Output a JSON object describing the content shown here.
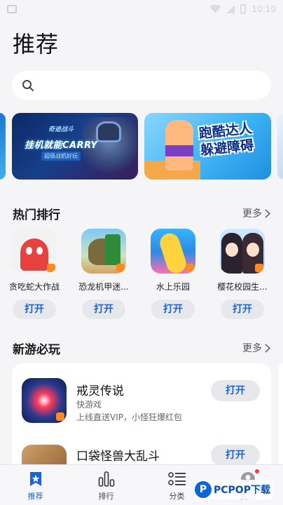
{
  "status_bar": {
    "time": "10:10"
  },
  "page": {
    "title": "推荐"
  },
  "search": {
    "placeholder": ""
  },
  "banners": [
    {
      "subtitle": "奇迹战斗",
      "headline": "挂机就能CARRY",
      "tag": "超级战机好玩"
    },
    {
      "headline_line1": "跑酷达人",
      "headline_line2": "躲避障碍"
    }
  ],
  "hot_section": {
    "title": "热门排行",
    "more": "更多",
    "items": [
      {
        "name": "贪吃蛇大作战",
        "button": "打开"
      },
      {
        "name": "恐龙机甲迷...",
        "button": "打开"
      },
      {
        "name": "水上乐园",
        "button": "打开"
      },
      {
        "name": "樱花校园生...",
        "button": "打开"
      }
    ]
  },
  "new_section": {
    "title": "新游必玩",
    "more": "更多",
    "items": [
      {
        "name": "戒灵传说",
        "category": "快游戏",
        "description": "上线直送VIP，小怪狂爆红包",
        "button": "打开"
      },
      {
        "name": "口袋怪兽大乱斗",
        "category": "",
        "description": "",
        "button": "打开"
      }
    ]
  },
  "tab_bar": {
    "tabs": [
      {
        "label": "推荐",
        "active": true
      },
      {
        "label": "排行"
      },
      {
        "label": "分类"
      },
      {
        "label": "我的"
      }
    ]
  },
  "watermark": {
    "logo": "P",
    "text": "PCPOP下载"
  },
  "colors": {
    "accent": "#1b63d8",
    "button_bg": "#e6e8ec",
    "background": "#f5f5f7",
    "badge": "#ff8a1f"
  }
}
